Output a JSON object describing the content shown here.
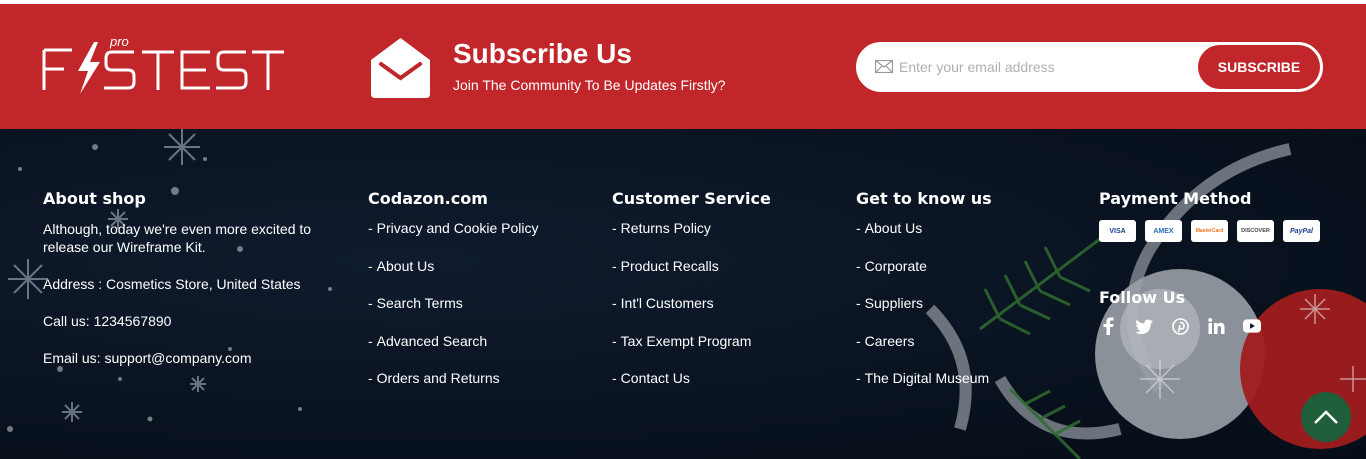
{
  "brand": {
    "logo": "FASTEST",
    "logo_sup": "pro"
  },
  "subscribe": {
    "title": "Subscribe Us",
    "desc": "Join The Community To Be Updates Firstly?",
    "placeholder": "Enter your email address",
    "button": "SUBSCRIBE"
  },
  "about": {
    "title": "About shop",
    "text": "Although, today we're even more excited to release our Wireframe Kit.",
    "address": "Address : Cosmetics Store, United States",
    "call": "Call us: 1234567890",
    "email": "Email us: support@company.com"
  },
  "codazon": {
    "title": "Codazon.com",
    "links": [
      "Privacy and Cookie Policy",
      "About Us",
      "Search Terms",
      "Advanced Search",
      "Orders and Returns"
    ]
  },
  "customer": {
    "title": "Customer Service",
    "links": [
      "Returns Policy",
      "Product Recalls",
      "Int'l Customers",
      "Tax Exempt Program",
      "Contact Us"
    ]
  },
  "know": {
    "title": "Get to know us",
    "links": [
      "About Us",
      "Corporate",
      "Suppliers",
      "Careers",
      "The Digital Museum"
    ]
  },
  "payment": {
    "title": "Payment Method",
    "cards": [
      "VISA",
      "AMEX",
      "MasterCard",
      "DISCOVER",
      "PayPal"
    ]
  },
  "follow": {
    "title": "Follow Us",
    "icons": [
      "facebook-icon",
      "twitter-icon",
      "pinterest-icon",
      "linkedin-icon",
      "youtube-icon"
    ]
  },
  "colors": {
    "accent": "#c1262a",
    "footer_bg": "#09121f",
    "scroll_btn": "#1e5e3a"
  }
}
